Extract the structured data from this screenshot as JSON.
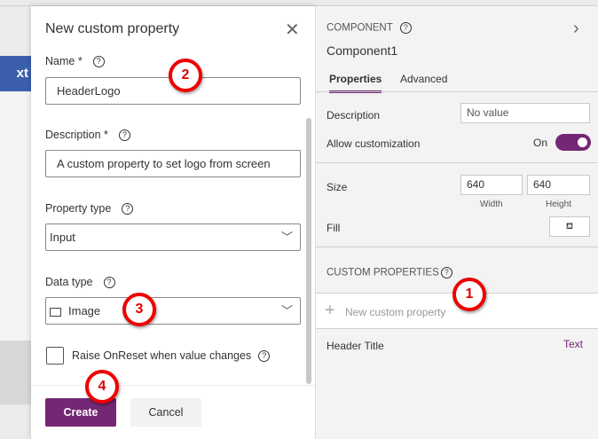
{
  "background": {
    "button_text": "xt"
  },
  "dialog": {
    "title": "New custom property",
    "name_label": "Name *",
    "name_value": "HeaderLogo",
    "description_label": "Description *",
    "description_value": "A custom property to set logo from screen",
    "property_type_label": "Property type",
    "property_type_value": "Input",
    "data_type_label": "Data type",
    "data_type_value": "Image",
    "raise_onreset_label": "Raise OnReset when value changes",
    "create_label": "Create",
    "cancel_label": "Cancel"
  },
  "panel": {
    "section": "COMPONENT",
    "name": "Component1",
    "tabs": [
      "Properties",
      "Advanced"
    ],
    "description_label": "Description",
    "description_placeholder": "No value",
    "allow_customization_label": "Allow customization",
    "allow_customization_value": "On",
    "size_label": "Size",
    "width": "640",
    "height": "640",
    "width_label": "Width",
    "height_label": "Height",
    "fill_label": "Fill",
    "custom_properties_label": "CUSTOM PROPERTIES",
    "new_custom_property": "New custom property",
    "properties": [
      {
        "name": "Header Title",
        "type": "Text"
      }
    ]
  },
  "annotations": [
    "1",
    "2",
    "3",
    "4"
  ],
  "colors": {
    "accent": "#742774",
    "annotation": "#e00000"
  }
}
